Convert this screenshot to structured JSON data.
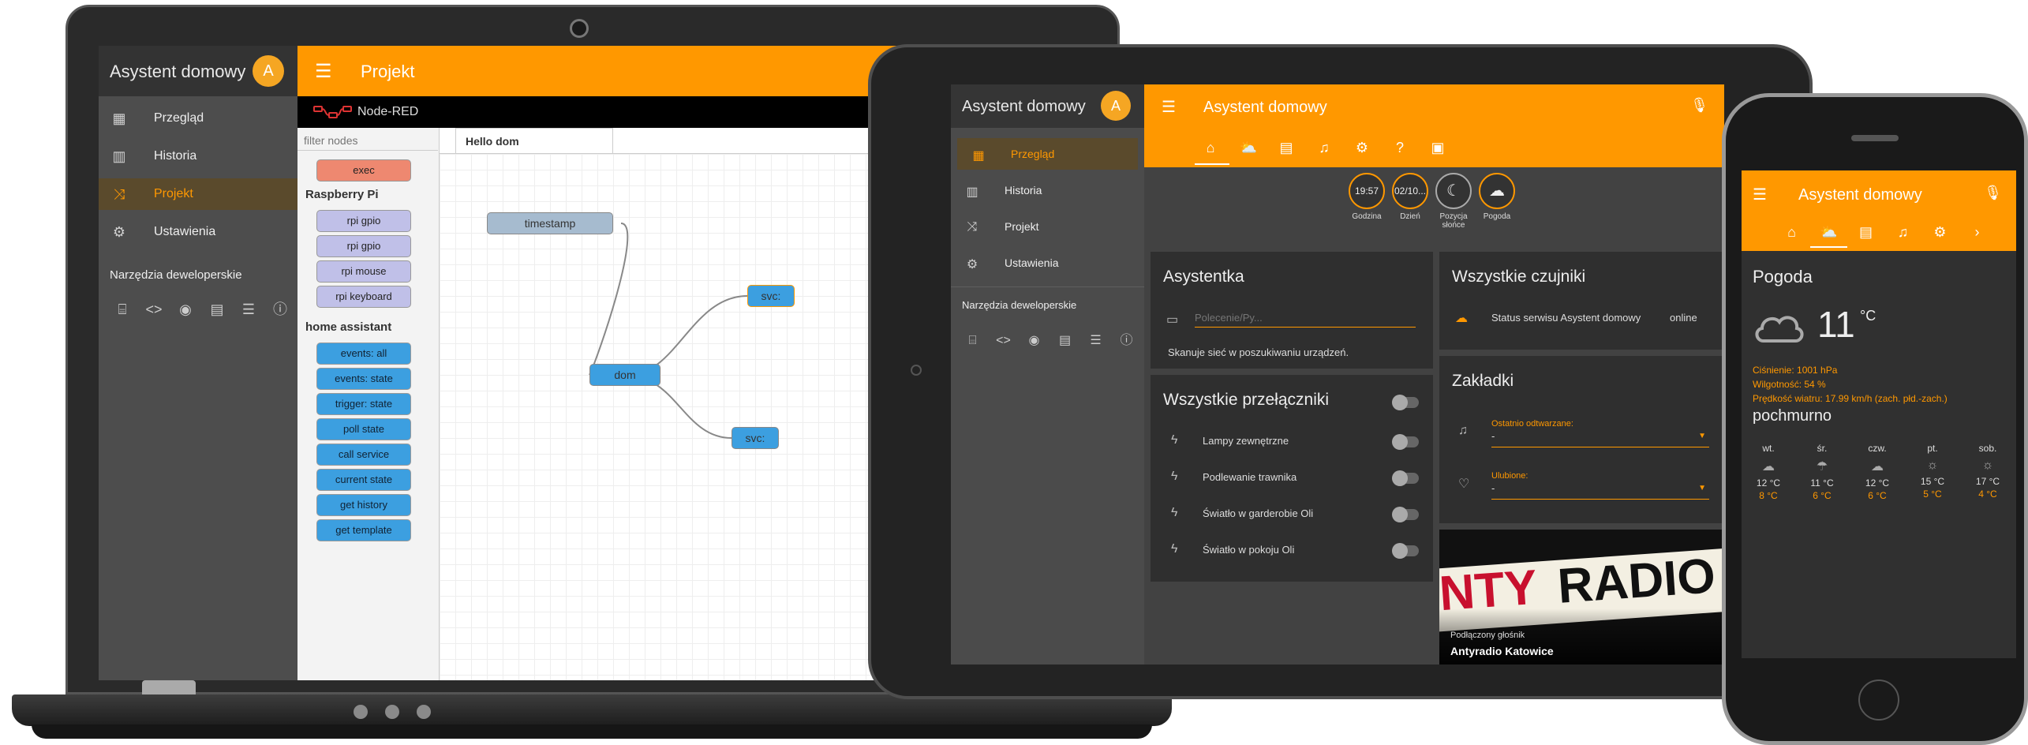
{
  "laptop": {
    "sidebar": {
      "title": "Asystent domowy",
      "avatar": "A",
      "items": [
        {
          "label": "Przegląd",
          "icon": "grid-icon"
        },
        {
          "label": "Historia",
          "icon": "chart-icon"
        },
        {
          "label": "Projekt",
          "icon": "shuffle-icon"
        },
        {
          "label": "Ustawienia",
          "icon": "gear-icon"
        }
      ],
      "dev_header": "Narzędzia deweloperskie"
    },
    "topbar": {
      "title": "Projekt"
    },
    "nodered": {
      "name": "Node-RED",
      "filter_placeholder": "filter nodes",
      "exec": "exec",
      "cat_pi": "Raspberry Pi",
      "pi_nodes": [
        "rpi gpio",
        "rpi gpio",
        "rpi mouse",
        "rpi keyboard"
      ],
      "cat_ha": "home assistant",
      "ha_nodes": [
        "events: all",
        "events: state",
        "trigger: state",
        "poll state",
        "call service",
        "current state",
        "get history",
        "get template"
      ],
      "tab": "Hello dom",
      "flow": {
        "timestamp": "timestamp",
        "dom": "dom",
        "svc1": "svc:",
        "svc2": "svc:"
      }
    }
  },
  "tablet": {
    "sidebar": {
      "title": "Asystent domowy",
      "avatar": "A",
      "items": [
        "Przegląd",
        "Historia",
        "Projekt",
        "Ustawienia"
      ],
      "dev_header": "Narzędzia deweloperskie"
    },
    "topbar": {
      "title": "Asystent domowy"
    },
    "badges": [
      {
        "value": "19:57",
        "label": "Godzina"
      },
      {
        "value": "02/10...",
        "label": "Dzień"
      },
      {
        "value": "☾",
        "label": "Pozycja słońce"
      },
      {
        "value": "☁",
        "label": "Pogoda"
      }
    ],
    "assistant": {
      "title": "Asystentka",
      "placeholder": "Polecenie/Py...",
      "status": "Skanuje sieć w poszukiwaniu urządzeń."
    },
    "switches": {
      "title": "Wszystkie przełączniki",
      "items": [
        "Lampy zewnętrzne",
        "Podlewanie trawnika",
        "Światło w garderobie Oli",
        "Światło w pokoju Oli"
      ]
    },
    "sensors": {
      "title": "Wszystkie czujniki",
      "name": "Status serwisu Asystent domowy",
      "value": "online"
    },
    "bookmarks": {
      "title": "Zakładki",
      "recent_label": "Ostatnio odtwarzane:",
      "recent_value": "-",
      "fav_label": "Ulubione:",
      "fav_value": "-"
    },
    "media": {
      "logo_left": "NTY",
      "logo_right": "RADIO",
      "caption": "Podłączony głośnik",
      "station": "Antyradio Katowice"
    }
  },
  "phone": {
    "topbar": {
      "title": "Asystent domowy"
    },
    "weather": {
      "title": "Pogoda",
      "temp": "11",
      "unit": "°C",
      "pressure": "Ciśnienie: 1001 hPa",
      "humidity": "Wilgotność: 54 %",
      "wind": "Prędkość wiatru: 17.99 km/h (zach. płd.-zach.)",
      "condition": "pochmurno",
      "forecast": [
        {
          "day": "wt.",
          "hi": "12 °C",
          "lo": "8 °C",
          "icon": "cloud-icon"
        },
        {
          "day": "śr.",
          "hi": "11 °C",
          "lo": "6 °C",
          "icon": "rain-icon"
        },
        {
          "day": "czw.",
          "hi": "12 °C",
          "lo": "6 °C",
          "icon": "cloud-icon"
        },
        {
          "day": "pt.",
          "hi": "15 °C",
          "lo": "5 °C",
          "icon": "sun-icon"
        },
        {
          "day": "sob.",
          "hi": "17 °C",
          "lo": "4 °C",
          "icon": "sun-icon"
        }
      ]
    }
  },
  "colors": {
    "accent": "#ff9800",
    "dark": "#424242"
  }
}
